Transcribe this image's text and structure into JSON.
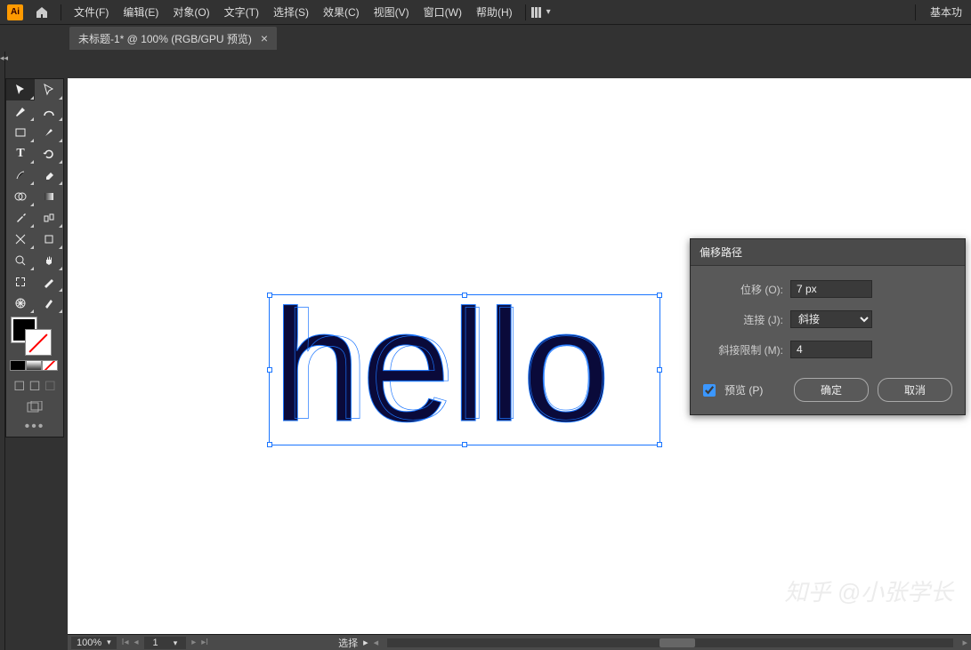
{
  "menu": {
    "file": "文件(F)",
    "edit": "编辑(E)",
    "object": "对象(O)",
    "type": "文字(T)",
    "select": "选择(S)",
    "effect": "效果(C)",
    "view": "视图(V)",
    "window": "窗口(W)",
    "help": "帮助(H)"
  },
  "workspace": {
    "label": "基本功"
  },
  "tab": {
    "title": "未标题-1* @ 100% (RGB/GPU 预览)"
  },
  "canvas": {
    "text": "hello"
  },
  "dialog": {
    "title": "偏移路径",
    "offset_label": "位移 (O):",
    "offset_value": "7 px",
    "join_label": "连接 (J):",
    "join_value": "斜接",
    "miter_label": "斜接限制 (M):",
    "miter_value": "4",
    "preview_label": "预览 (P)",
    "preview_checked": true,
    "ok": "确定",
    "cancel": "取消"
  },
  "status": {
    "zoom": "100%",
    "artboard": "1",
    "tool": "选择"
  },
  "watermark": "知乎 @小张学长",
  "chart_data": null
}
